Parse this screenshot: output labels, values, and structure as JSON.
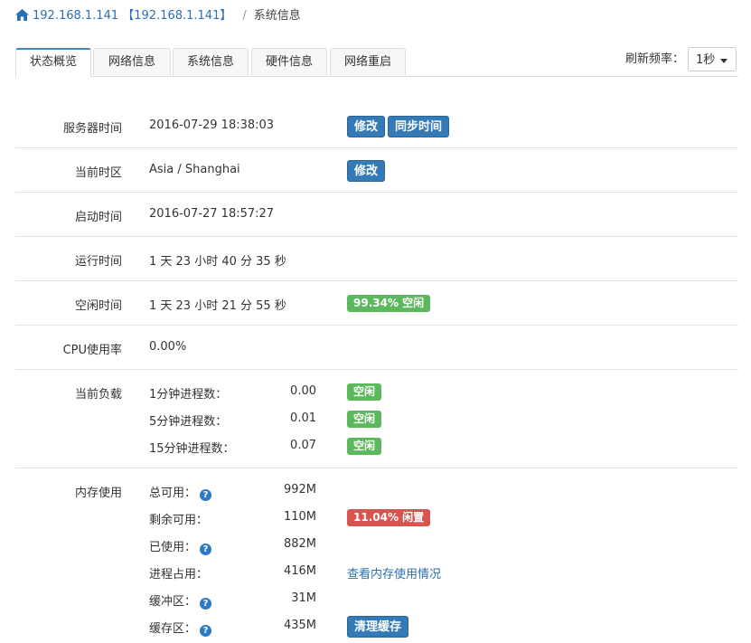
{
  "breadcrumb": {
    "home_link": "192.168.1.141 【192.168.1.141】",
    "separator": "/",
    "current": "系统信息"
  },
  "tabs": [
    "状态概览",
    "网络信息",
    "系统信息",
    "硬件信息",
    "网络重启"
  ],
  "active_tab": 0,
  "refresh": {
    "label": "刷新频率：",
    "value": "1秒"
  },
  "server_time": {
    "label": "服务器时间",
    "value": "2016-07-29 18:38:03",
    "edit_btn": "修改",
    "sync_btn": "同步时间"
  },
  "timezone": {
    "label": "当前时区",
    "value": "Asia / Shanghai",
    "edit_btn": "修改"
  },
  "boot_time": {
    "label": "启动时间",
    "value": "2016-07-27 18:57:27"
  },
  "uptime": {
    "label": "运行时间",
    "value": "1 天 23 小时 40 分 35 秒"
  },
  "idle_time": {
    "label": "空闲时间",
    "value": "1 天 23 小时 21 分 55 秒",
    "badge": "99.34% 空闲"
  },
  "cpu": {
    "label": "CPU使用率",
    "value": "0.00%"
  },
  "load": {
    "label": "当前负载",
    "rows": [
      {
        "label": "1分钟进程数：",
        "value": "0.00",
        "badge": "空闲"
      },
      {
        "label": "5分钟进程数：",
        "value": "0.01",
        "badge": "空闲"
      },
      {
        "label": "15分钟进程数：",
        "value": "0.07",
        "badge": "空闲"
      }
    ]
  },
  "memory": {
    "label": "内存使用",
    "total": {
      "label": "总可用：",
      "value": "992M"
    },
    "free": {
      "label": "剩余可用：",
      "value": "110M",
      "badge": "11.04% 闲置"
    },
    "used": {
      "label": "已使用：",
      "value": "882M"
    },
    "process": {
      "label": "进程占用：",
      "value": "416M",
      "link": "查看内存使用情况"
    },
    "buffer": {
      "label": "缓冲区：",
      "value": "31M"
    },
    "cache": {
      "label": "缓存区：",
      "value": "435M",
      "btn": "清理缓存"
    }
  },
  "colors": {
    "primary": "#337ab7",
    "success": "#5cb85c",
    "danger": "#d9534f",
    "link": "#2a6fb3"
  },
  "icons": {
    "home": "home-icon",
    "help": "question-icon",
    "dropdown": "caret-down-icon"
  }
}
